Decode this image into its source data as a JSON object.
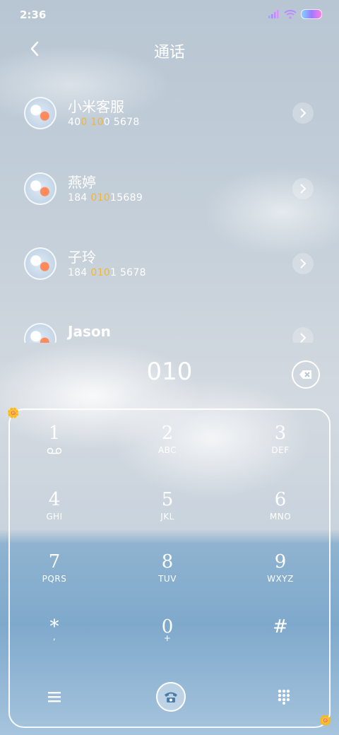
{
  "status": {
    "time": "2:36"
  },
  "header": {
    "title": "通话"
  },
  "contacts": [
    {
      "name": "小米客服",
      "num_a": "40",
      "num_b": "0 10",
      "num_c": "0 5678"
    },
    {
      "name": "燕婷",
      "num_a": "184 ",
      "num_b": "010",
      "num_c": "15689"
    },
    {
      "name": "子玲",
      "num_a": "184 ",
      "num_b": "010",
      "num_c": "1 5678"
    },
    {
      "name": "Jason",
      "num_a": "",
      "num_b": "",
      "num_c": ""
    }
  ],
  "dialer": {
    "entered_number": "010",
    "keys": [
      {
        "digit": "1",
        "letters": ""
      },
      {
        "digit": "2",
        "letters": "ABC"
      },
      {
        "digit": "3",
        "letters": "DEF"
      },
      {
        "digit": "4",
        "letters": "GHI"
      },
      {
        "digit": "5",
        "letters": "JKL"
      },
      {
        "digit": "6",
        "letters": "MNO"
      },
      {
        "digit": "7",
        "letters": "PQRS"
      },
      {
        "digit": "8",
        "letters": "TUV"
      },
      {
        "digit": "9",
        "letters": "WXYZ"
      },
      {
        "digit": "*",
        "letters": ","
      },
      {
        "digit": "0",
        "letters": "+"
      },
      {
        "digit": "#",
        "letters": ""
      }
    ]
  },
  "colors": {
    "highlight": "#f2b63a",
    "text": "#ffffff"
  },
  "icons": [
    "signal-icon",
    "wifi-icon",
    "battery-icon",
    "back-arrow-icon",
    "chevron-right-icon",
    "backspace-icon",
    "voicemail-icon",
    "menu-icon",
    "phone-icon",
    "keypad-icon",
    "flower-icon"
  ]
}
